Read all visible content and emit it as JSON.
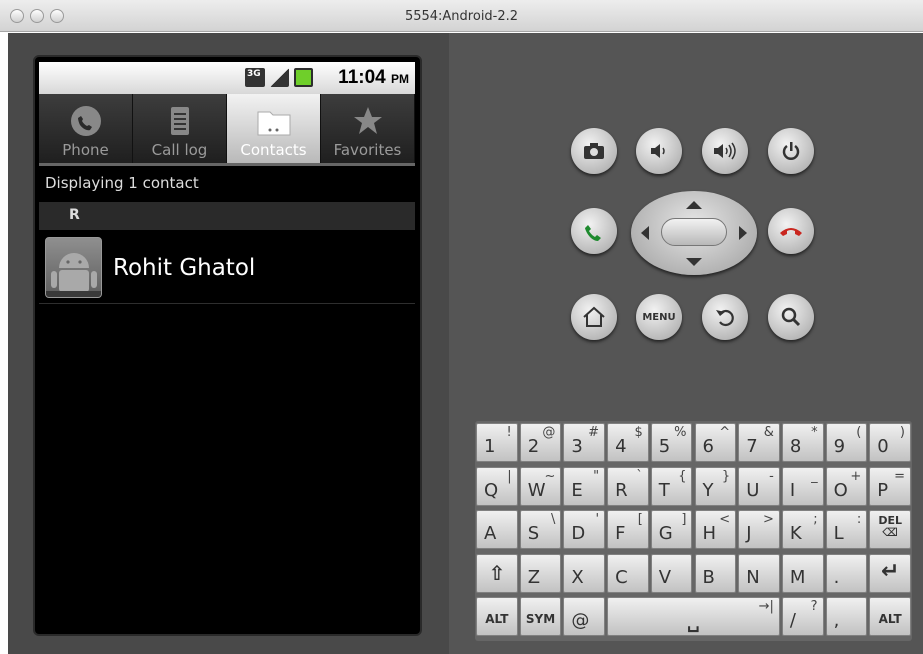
{
  "window": {
    "title": "5554:Android-2.2"
  },
  "statusbar": {
    "net_label": "3G",
    "time": "11:04",
    "ampm": "PM"
  },
  "tabs": [
    {
      "label": "Phone",
      "icon": "phone-icon",
      "selected": false
    },
    {
      "label": "Call log",
      "icon": "call-log-icon",
      "selected": false
    },
    {
      "label": "Contacts",
      "icon": "contacts-icon",
      "selected": true
    },
    {
      "label": "Favorites",
      "icon": "star-icon",
      "selected": false
    }
  ],
  "contacts": {
    "count_text": "Displaying 1 contact",
    "section": "R",
    "items": [
      {
        "name": "Rohit Ghatol"
      }
    ]
  },
  "controls": {
    "menu_label": "MENU"
  },
  "keyboard": {
    "rows": [
      [
        [
          "1",
          "!"
        ],
        [
          "2",
          "@"
        ],
        [
          "3",
          "#"
        ],
        [
          "4",
          "$"
        ],
        [
          "5",
          "%"
        ],
        [
          "6",
          "^"
        ],
        [
          "7",
          "&"
        ],
        [
          "8",
          "*"
        ],
        [
          "9",
          "("
        ],
        [
          "0",
          ")"
        ]
      ],
      [
        [
          "Q",
          "|"
        ],
        [
          "W",
          "~"
        ],
        [
          "E",
          "\""
        ],
        [
          "R",
          "`"
        ],
        [
          "T",
          "{"
        ],
        [
          "Y",
          "}"
        ],
        [
          "U",
          "-"
        ],
        [
          "I",
          "_"
        ],
        [
          "O",
          "+"
        ],
        [
          "P",
          "="
        ]
      ],
      [
        [
          "A",
          ""
        ],
        [
          "S",
          "\\"
        ],
        [
          "D",
          "'"
        ],
        [
          "F",
          "["
        ],
        [
          "G",
          "]"
        ],
        [
          "H",
          "<"
        ],
        [
          "J",
          ">"
        ],
        [
          "K",
          ";"
        ],
        [
          "L",
          ":"
        ],
        [
          "DEL",
          ""
        ]
      ],
      [
        [
          "SHIFT",
          ""
        ],
        [
          "Z",
          ""
        ],
        [
          "X",
          ""
        ],
        [
          "C",
          ""
        ],
        [
          "V",
          ""
        ],
        [
          "B",
          ""
        ],
        [
          "N",
          ""
        ],
        [
          "M",
          ""
        ],
        [
          ".",
          ""
        ],
        [
          "ENTER",
          ""
        ]
      ],
      [
        [
          "ALT",
          ""
        ],
        [
          "SYM",
          ""
        ],
        [
          "@",
          ""
        ],
        [
          "SPACE",
          ""
        ],
        [
          "/",
          "?"
        ],
        [
          ",",
          ""
        ],
        [
          "ALT",
          ""
        ]
      ]
    ]
  }
}
